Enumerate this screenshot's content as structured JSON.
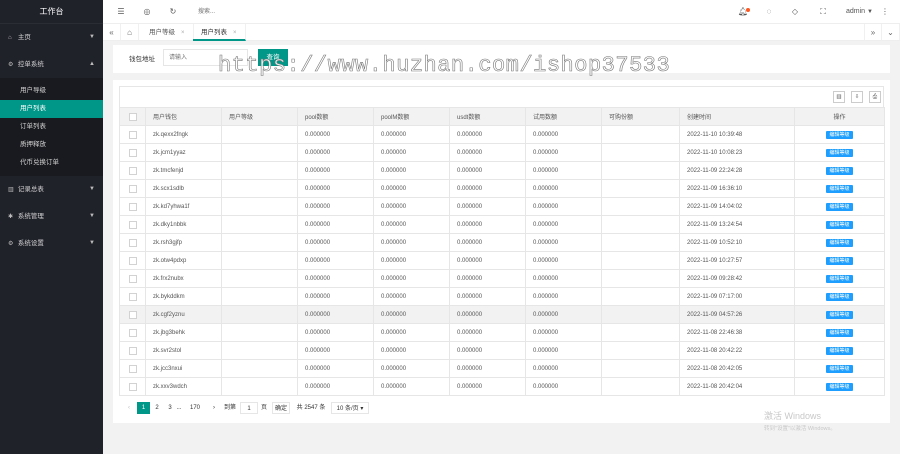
{
  "sidebar": {
    "logo": "工作台",
    "items": [
      {
        "label": "主页",
        "icon": "home-icon"
      },
      {
        "label": "控单系统",
        "icon": "gear-icon",
        "expanded": true
      },
      {
        "label": "记录总表",
        "icon": "list-icon"
      },
      {
        "label": "系统管理",
        "icon": "settings-icon"
      },
      {
        "label": "系统设置",
        "icon": "gear-icon"
      }
    ],
    "submenu": [
      "用户导级",
      "用户列表",
      "订单列表",
      "质押释放",
      "代币兑换订单"
    ]
  },
  "header": {
    "search_placeholder": "搜索...",
    "user": "admin"
  },
  "tabs": [
    {
      "label": "用户等级"
    },
    {
      "label": "用户列表",
      "active": true
    }
  ],
  "filter": {
    "label": "钱包地址",
    "input_placeholder": "请输入",
    "button": "查询"
  },
  "table": {
    "columns": [
      "用户钱包",
      "用户等级",
      "pool数额",
      "poolM数额",
      "usdt数额",
      "试用数额",
      "可购份额",
      "创建时间",
      "操作"
    ],
    "rows": [
      {
        "wallet": "zk.qexx2fngk",
        "level": "",
        "pool": "0.000000",
        "poolm": "0.000000",
        "usdt": "0.000000",
        "trial": "0.000000",
        "share": "",
        "created": "2022-11-10 10:39:48",
        "action": "编辑等级"
      },
      {
        "wallet": "zk.jcm1yyaz",
        "level": "",
        "pool": "0.000000",
        "poolm": "0.000000",
        "usdt": "0.000000",
        "trial": "0.000000",
        "share": "",
        "created": "2022-11-10 10:08:23",
        "action": "编辑等级"
      },
      {
        "wallet": "zk.tmcfenjd",
        "level": "",
        "pool": "0.000000",
        "poolm": "0.000000",
        "usdt": "0.000000",
        "trial": "0.000000",
        "share": "",
        "created": "2022-11-09 22:24:28",
        "action": "编辑等级"
      },
      {
        "wallet": "zk.scx1sdlb",
        "level": "",
        "pool": "0.000000",
        "poolm": "0.000000",
        "usdt": "0.000000",
        "trial": "0.000000",
        "share": "",
        "created": "2022-11-09 16:36:10",
        "action": "编辑等级"
      },
      {
        "wallet": "zk.kd7yhwa1f",
        "level": "",
        "pool": "0.000000",
        "poolm": "0.000000",
        "usdt": "0.000000",
        "trial": "0.000000",
        "share": "",
        "created": "2022-11-09 14:04:02",
        "action": "编辑等级"
      },
      {
        "wallet": "zk.dky1nbbk",
        "level": "",
        "pool": "0.000000",
        "poolm": "0.000000",
        "usdt": "0.000000",
        "trial": "0.000000",
        "share": "",
        "created": "2022-11-09 13:24:54",
        "action": "编辑等级"
      },
      {
        "wallet": "zk.rsh3gjfp",
        "level": "",
        "pool": "0.000000",
        "poolm": "0.000000",
        "usdt": "0.000000",
        "trial": "0.000000",
        "share": "",
        "created": "2022-11-09 10:52:10",
        "action": "编辑等级"
      },
      {
        "wallet": "zk.otw4pdxp",
        "level": "",
        "pool": "0.000000",
        "poolm": "0.000000",
        "usdt": "0.000000",
        "trial": "0.000000",
        "share": "",
        "created": "2022-11-09 10:27:57",
        "action": "编辑等级"
      },
      {
        "wallet": "zk.frx2nubx",
        "level": "",
        "pool": "0.000000",
        "poolm": "0.000000",
        "usdt": "0.000000",
        "trial": "0.000000",
        "share": "",
        "created": "2022-11-09 09:28:42",
        "action": "编辑等级"
      },
      {
        "wallet": "zk.bykddkm",
        "level": "",
        "pool": "0.000000",
        "poolm": "0.000000",
        "usdt": "0.000000",
        "trial": "0.000000",
        "share": "",
        "created": "2022-11-09 07:17:00",
        "action": "编辑等级"
      },
      {
        "wallet": "zk.cgf2yznu",
        "level": "",
        "pool": "0.000000",
        "poolm": "0.000000",
        "usdt": "0.000000",
        "trial": "0.000000",
        "share": "",
        "created": "2022-11-09 04:57:26",
        "action": "编辑等级"
      },
      {
        "wallet": "zk.jbg3behk",
        "level": "",
        "pool": "0.000000",
        "poolm": "0.000000",
        "usdt": "0.000000",
        "trial": "0.000000",
        "share": "",
        "created": "2022-11-08 22:46:38",
        "action": "编辑等级"
      },
      {
        "wallet": "zk.svr2stol",
        "level": "",
        "pool": "0.000000",
        "poolm": "0.000000",
        "usdt": "0.000000",
        "trial": "0.000000",
        "share": "",
        "created": "2022-11-08 20:42:22",
        "action": "编辑等级"
      },
      {
        "wallet": "zk.jcc3nxui",
        "level": "",
        "pool": "0.000000",
        "poolm": "0.000000",
        "usdt": "0.000000",
        "trial": "0.000000",
        "share": "",
        "created": "2022-11-08 20:42:05",
        "action": "编辑等级"
      },
      {
        "wallet": "zk.xxv3wdch",
        "level": "",
        "pool": "0.000000",
        "poolm": "0.000000",
        "usdt": "0.000000",
        "trial": "0.000000",
        "share": "",
        "created": "2022-11-08 20:42:04",
        "action": "编辑等级"
      }
    ]
  },
  "pager": {
    "prev": "‹",
    "pages": [
      "1",
      "2",
      "3",
      "...",
      "170"
    ],
    "next": "›",
    "goto_label": "到第",
    "goto_value": "1",
    "page_unit": "页",
    "confirm": "确定",
    "total": "共 2547 条",
    "per_page": "10 条/页"
  },
  "watermark": "https://www.huzhan.com/ishop37533",
  "activate": {
    "line1": "激活 Windows",
    "line2": "转到\"设置\"以激活 Windows。"
  },
  "colors": {
    "primary": "#009688",
    "action": "#1e9fff",
    "sidebar": "#20222a"
  }
}
